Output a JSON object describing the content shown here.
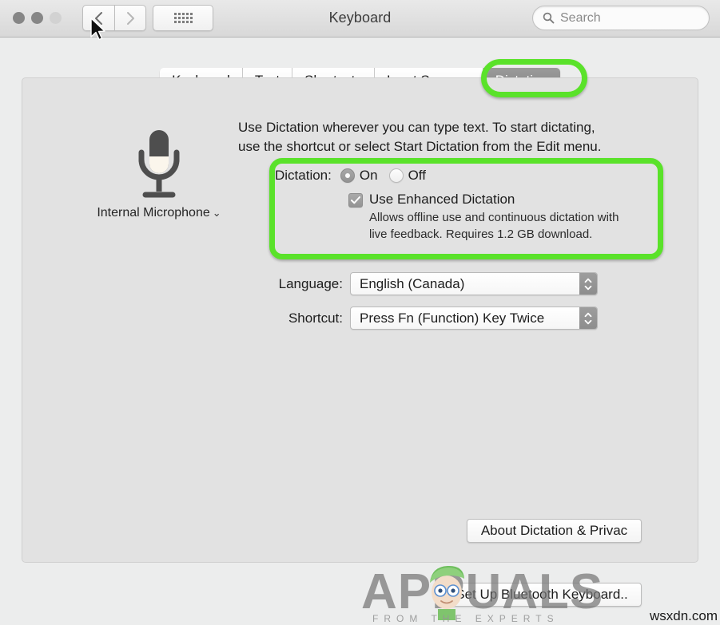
{
  "window": {
    "title": "Keyboard",
    "traffic_lights": [
      "close",
      "minimize",
      "zoom"
    ],
    "nav": {
      "back_icon": "chevron-left-icon",
      "forward_icon": "chevron-right-icon",
      "show_all_icon": "grid-dots-icon"
    },
    "search": {
      "placeholder": "Search",
      "value": "",
      "icon": "search-icon"
    }
  },
  "tabs": [
    {
      "label": "Keyboard",
      "active": false
    },
    {
      "label": "Text",
      "active": false
    },
    {
      "label": "Shortcuts",
      "active": false
    },
    {
      "label": "Input Sources",
      "active": false
    },
    {
      "label": "Dictation",
      "active": true
    }
  ],
  "main": {
    "mic": {
      "icon": "microphone-icon",
      "label": "Internal Microphone",
      "chevron": "⌄"
    },
    "intro_line1": "Use Dictation wherever you can type text. To start dictating,",
    "intro_line2": "use the shortcut or select Start Dictation from the Edit menu.",
    "dictation": {
      "label": "Dictation:",
      "on_label": "On",
      "off_label": "Off",
      "selected": "On",
      "enhanced": {
        "label": "Use Enhanced Dictation",
        "checked": true,
        "description_line1": "Allows offline use and continuous dictation with",
        "description_line2": "live feedback. Requires 1.2 GB download."
      }
    },
    "language": {
      "label": "Language:",
      "value": "English (Canada)"
    },
    "shortcut": {
      "label": "Shortcut:",
      "value": "Press Fn (Function) Key Twice"
    },
    "about_button": "About Dictation & Privac",
    "bluetooth_button": "Set Up Bluetooth Keyboard.."
  },
  "annotations": {
    "color": "#5ae22a",
    "highlighted": [
      "dictation-tab",
      "dictation-settings-group"
    ]
  },
  "watermark": {
    "brand": "APPUALS",
    "tagline": "FROM THE EXPERTS",
    "site": "wsxdn.com"
  }
}
